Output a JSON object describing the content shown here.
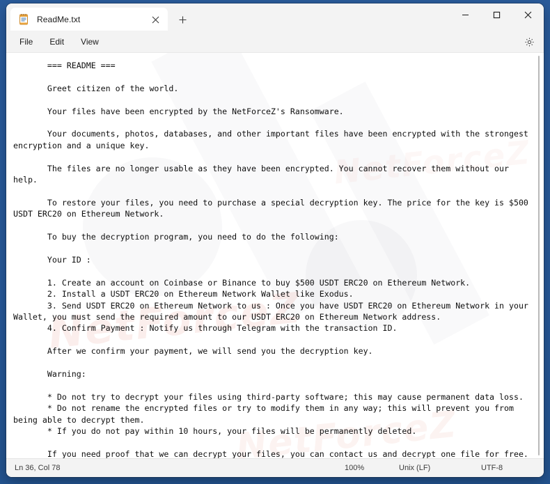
{
  "window": {
    "app_icon": "notepad-icon",
    "tab_label": "ReadMe.txt",
    "close_tab_icon": "close-icon",
    "new_tab_icon": "plus-icon",
    "minimize_icon": "minimize-icon",
    "maximize_icon": "maximize-icon",
    "close_icon": "close-icon"
  },
  "menu": {
    "items": [
      {
        "label": "File",
        "name": "menu-file"
      },
      {
        "label": "Edit",
        "name": "menu-edit"
      },
      {
        "label": "View",
        "name": "menu-view"
      }
    ],
    "settings_icon": "gear-icon"
  },
  "document": {
    "content": "       === README ===\n\n       Greet citizen of the world.\n\n       Your files have been encrypted by the NetForceZ's Ransomware.\n\n       Your documents, photos, databases, and other important files have been encrypted with the strongest encryption and a unique key.\n\n       The files are no longer usable as they have been encrypted. You cannot recover them without our help.\n\n       To restore your files, you need to purchase a special decryption key. The price for the key is $500 USDT ERC20 on Ethereum Network.\n\n       To buy the decryption program, you need to do the following:\n\n       Your ID :\n\n       1. Create an account on Coinbase or Binance to buy $500 USDT ERC20 on Ethereum Network.\n       2. Install a USDT ERC20 on Ethereum Network Wallet like Exodus.\n       3. Send USDT ERC20 on Ethereum Network to us : Once you have USDT ERC20 on Ethereum Network in your Wallet, you must send the required amount to our USDT ERC20 on Ethereum Network address.\n       4. Confirm Payment : Notify us through Telegram with the transaction ID.\n\n       After we confirm your payment, we will send you the decryption key.\n\n       Warning:\n\n       * Do not try to decrypt your files using third-party software; this may cause permanent data loss.\n       * Do not rename the encrypted files or try to modify them in any way; this will prevent you from being able to decrypt them.\n       * If you do not pay within 10 hours, your files will be permanently deleted.\n\n       If you need proof that we can decrypt your files, you can contact us and decrypt one file for free.\n\n       Contact us on Telegram at: @xpolarized | @ZZART3XX\n       Contact us on Tox at : 498F8B96D058FEB29A315C4572117E753F471847AFDF37E0A9896F6FFA5530547680628F8134\n\n       Our USDT ERC20 on Ethereum Network address : 0xdF0f41d46Dd8Be583F9a69b4a85A600C8Af7f4Ad\n\n       Remember, we are the only ones who can help you recover your files.\n\n       === END OF README ===",
    "watermark_text": "NetForceZ"
  },
  "statusbar": {
    "cursor_position": "Ln 36, Col 78",
    "zoom": "100%",
    "line_ending": "Unix (LF)",
    "encoding": "UTF-8"
  },
  "colors": {
    "desktop_blue": "#2a5b9b",
    "window_bg": "#f3f3f3",
    "editor_bg": "#ffffff",
    "text": "#0e0e0e",
    "close_hover": "#c42b1c"
  }
}
